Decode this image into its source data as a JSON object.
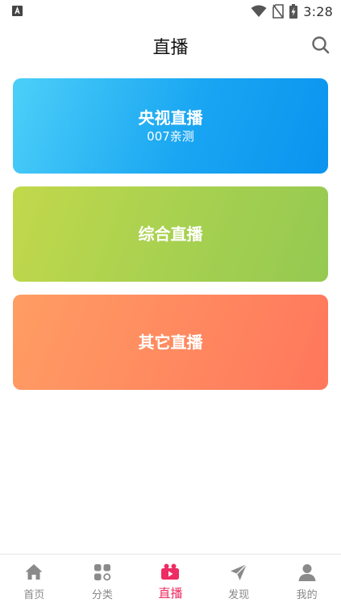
{
  "status_bar": {
    "time": "3:28",
    "icons": [
      "app-notification-icon",
      "wifi-icon",
      "no-sim-icon",
      "battery-charging-icon"
    ]
  },
  "header": {
    "title": "直播",
    "search_icon": "search-icon"
  },
  "cards": [
    {
      "title": "央视直播",
      "subtitle": "007亲测",
      "color": "#1aa6f2"
    },
    {
      "title": "综合直播",
      "subtitle": "",
      "color": "#a8d150"
    },
    {
      "title": "其它直播",
      "subtitle": "",
      "color": "#ff8a60"
    }
  ],
  "tab_bar": {
    "active_color": "#ee2b62",
    "inactive_color": "#888888",
    "items": [
      {
        "label": "首页",
        "icon": "home-icon"
      },
      {
        "label": "分类",
        "icon": "category-icon"
      },
      {
        "label": "直播",
        "icon": "live-camera-icon",
        "active": true
      },
      {
        "label": "发现",
        "icon": "discover-icon"
      },
      {
        "label": "我的",
        "icon": "profile-icon"
      }
    ]
  }
}
